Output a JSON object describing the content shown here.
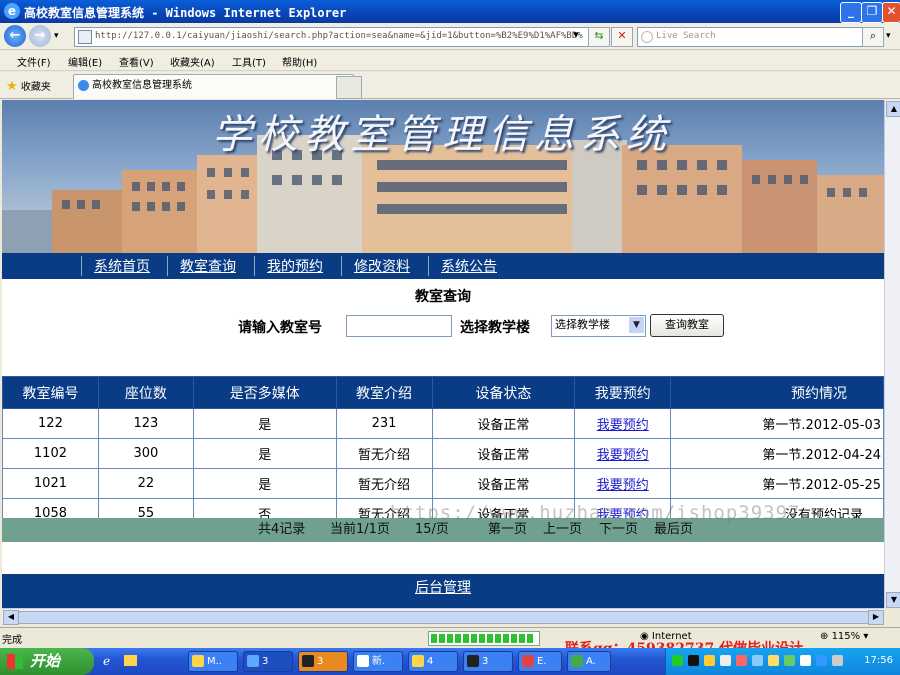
{
  "window": {
    "title": "高校教室信息管理系统 - Windows Internet Explorer"
  },
  "browser": {
    "url": "http://127.0.0.1/caiyuan/jiaoshi/search.php?action=sea&name=&jid=1&button=%B2%E9%D1%AF%BD%",
    "search_placeholder": "Live Search",
    "menu": [
      "文件(F)",
      "编辑(E)",
      "查看(V)",
      "收藏夹(A)",
      "工具(T)",
      "帮助(H)"
    ],
    "favorites_label": "收藏夹",
    "tab_title": "高校教室信息管理系统",
    "status_text": "完成",
    "zone": "Internet",
    "zoom": "115%"
  },
  "site": {
    "banner_title": "学校教室管理信息系统",
    "nav": [
      "系统首页",
      "教室查询",
      "我的预约",
      "修改资料",
      "系统公告"
    ],
    "page_title": "教室查询",
    "room_label": "请输入教室号",
    "room_value": "",
    "building_label": "选择教学楼",
    "building_selected": "选择教学楼",
    "query_button": "查询教室",
    "table": {
      "headers": [
        "教室编号",
        "座位数",
        "是否多媒体",
        "教室介绍",
        "设备状态",
        "我要预约",
        "预约情况"
      ],
      "rows": [
        [
          "122",
          "123",
          "是",
          "231",
          "设备正常",
          "我要预约",
          "第一节.2012-05-03"
        ],
        [
          "1102",
          "300",
          "是",
          "暂无介绍",
          "设备正常",
          "我要预约",
          "第一节.2012-04-24"
        ],
        [
          "1021",
          "22",
          "是",
          "暂无介绍",
          "设备正常",
          "我要预约",
          "第一节.2012-05-25"
        ],
        [
          "1058",
          "55",
          "否",
          "暂无介绍",
          "设备正常",
          "我要预约",
          "没有预约记录"
        ]
      ]
    },
    "pager": {
      "summary": "共4记录",
      "current": "当前1/1页",
      "per_page": "15/页",
      "first": "第一页",
      "prev": "上一页",
      "next": "下一页",
      "last": "最后页"
    },
    "footer_link": "后台管理",
    "watermark": "https://www.huzhan.com/ishop39397"
  },
  "overlay_contact": "联系qq：459382737 代做毕业设计",
  "taskbar": {
    "start": "开始",
    "items": [
      "M..",
      "3",
      "3",
      "新.",
      "4",
      "3",
      "E.",
      "A."
    ],
    "clock": "17:56"
  }
}
